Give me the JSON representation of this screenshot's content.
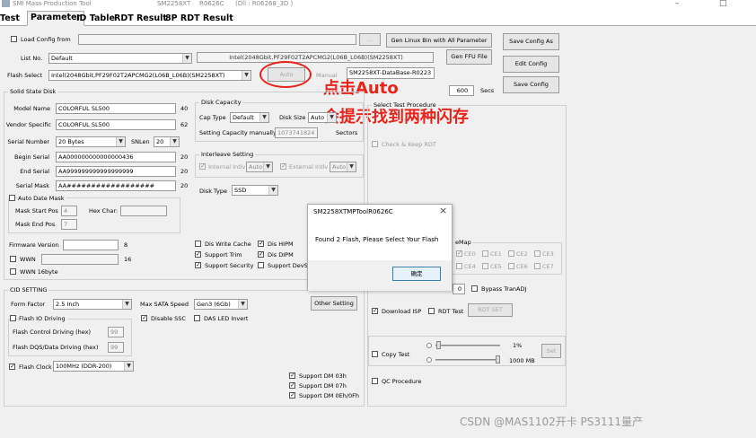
{
  "window": {
    "title": "SMI Mass Production Tool",
    "controller": "SM2258XT",
    "version": "R0626C",
    "dll": "(Dll : R06268_3D )",
    "minimize": "–",
    "maximize": "□",
    "close": "×"
  },
  "tabs": [
    {
      "label": "Test"
    },
    {
      "label": "Parameter"
    },
    {
      "label": "ID Table"
    },
    {
      "label": "RDT Result"
    },
    {
      "label": "8P RDT Result"
    }
  ],
  "top": {
    "load_config_label": "Load Config from",
    "load_config_value": "",
    "browse_label": "...",
    "list_no_label": "List No.",
    "list_no_value": "Default",
    "flash_info_line": "Intel(2048Gbit,PF29F02T2APCMG2(L06B_L06B)(SM2258XT)",
    "flash_select_label": "Flash Select",
    "flash_select_value": "Intel(2048Gbit,PF29F02T2APCMG2(L06B_L06B)(SM2258XT)",
    "auto_button": "Auto",
    "manual_button": "Manual",
    "database_value": "SM2258XT-DataBase-R0223",
    "gen_linux_button": "Gen Linux Bin with All Parameter",
    "gen_ffu_button": "Gen FFU File",
    "save_config_as_button": "Save Config As",
    "edit_config_button": "Edit Config",
    "save_config_button": "Save Config",
    "timeout_value": "600",
    "timeout_unit": "Secs"
  },
  "ssd": {
    "group_label": "Solid State Disk",
    "model_name_label": "Model Name",
    "model_name_value": "COLORFUL SL500",
    "model_name_len": "40",
    "vendor_label": "Vendor Specific",
    "vendor_value": "COLORFUL SL500",
    "vendor_len": "62",
    "serial_number_label": "Serial Number",
    "serial_number_value": "20 Bytes",
    "snlen_label": "SNLen",
    "snlen_value": "20",
    "begin_serial_label": "Begin Serial",
    "begin_serial_value": "AA000000000000000436",
    "begin_serial_len": "20",
    "end_serial_label": "End Serial",
    "end_serial_value": "AA999999999999999999",
    "end_serial_len": "20",
    "serial_mask_label": "Serial Mask",
    "serial_mask_value": "AA##################",
    "serial_mask_len": "20",
    "auto_date_mask_label": "Auto Date Mask",
    "mask_start_label": "Mask Start Pos",
    "mask_start_value": "4",
    "hex_char_label": "Hex Char:",
    "hex_char_value": "",
    "mask_end_label": "Mask End Pos",
    "mask_end_value": "7",
    "fw_version_label": "Firmware Version",
    "fw_version_value": "",
    "fw_version_len": "8",
    "wwn_label": "WWN",
    "wwn_value": "",
    "wwn_len": "16",
    "wwn16_label": "WWN 16byte"
  },
  "disk_capacity": {
    "group_label": "Disk Capacity",
    "cap_type_label": "Cap Type",
    "cap_type_value": "Default",
    "disk_size_label": "Disk Size",
    "disk_size_value": "Auto",
    "setting_manual_label": "Setting Capacity manually",
    "setting_manual_value": "1073741824",
    "sectors_label": "Sectors"
  },
  "interleave": {
    "group_label": "Interleave Setting",
    "internal_label": "Internal Intlv",
    "internal_value": "Auto",
    "external_label": "External Intlv",
    "external_value": "Auto"
  },
  "disk_type": {
    "label": "Disk Type",
    "value": "SSD"
  },
  "options": {
    "dis_write_cache": "Dis Write Cache",
    "dis_hipm": "Dis HIPM",
    "support_trim": "Support Trim",
    "dis_dipm": "Dis DIPM",
    "support_security": "Support Security",
    "support_devslp": "Support DevSlp"
  },
  "cid": {
    "group_label": "CID SETTING",
    "form_factor_label": "Form Factor",
    "form_factor_value": "2.5 Inch",
    "max_sata_label": "Max SATA Speed",
    "max_sata_value": "Gen3 (6Gb)",
    "other_setting_button": "Other Setting",
    "flash_io_label": "Flash IO Driving",
    "disable_ssc_label": "Disable SSC",
    "das_led_label": "DAS LED Invert",
    "flash_control_label": "Flash Control Driving (hex)",
    "flash_control_value": "99",
    "flash_dqs_label": "Flash DQS/Data Driving (hex)",
    "flash_dqs_value": "99",
    "flash_clock_label": "Flash Clock",
    "flash_clock_value": "100MHz (DDR-200)",
    "support_dm03": "Support DM 03h",
    "support_dm07": "Support DM 07h",
    "support_dm0e": "Support DM 0Eh/0Fh"
  },
  "test_procedure": {
    "group_label": "Select Test Procedure",
    "check_keep_rdt": "Check & Keep RDT",
    "ce_map_label": "eMap",
    "ce": [
      "CE0",
      "CE1",
      "CE2",
      "CE3",
      "CE4",
      "CE5",
      "CE6",
      "CE7"
    ],
    "bypass_label": "Bypass TranADJ",
    "bypass_value": "0",
    "download_isp": "Download ISP",
    "rdt_test": "RDT Test",
    "rdt_set_button": "RDT SET",
    "copy_test": "Copy Test",
    "percent_label": "1%",
    "mb_label": "1000 MB",
    "set_button": "Set",
    "qc_procedure": "QC Procedure"
  },
  "dialog": {
    "title": "SM2258XTMPToolR0626C",
    "message": "Found 2 Flash, Please Select Your Flash",
    "ok": "确定",
    "close": "×"
  },
  "annotation": {
    "line1": "点击Auto",
    "line2": "会提示找到两种闪存",
    "color": "#e8231b"
  },
  "watermark": "CSDN @MAS1102开卡 PS3111量产"
}
